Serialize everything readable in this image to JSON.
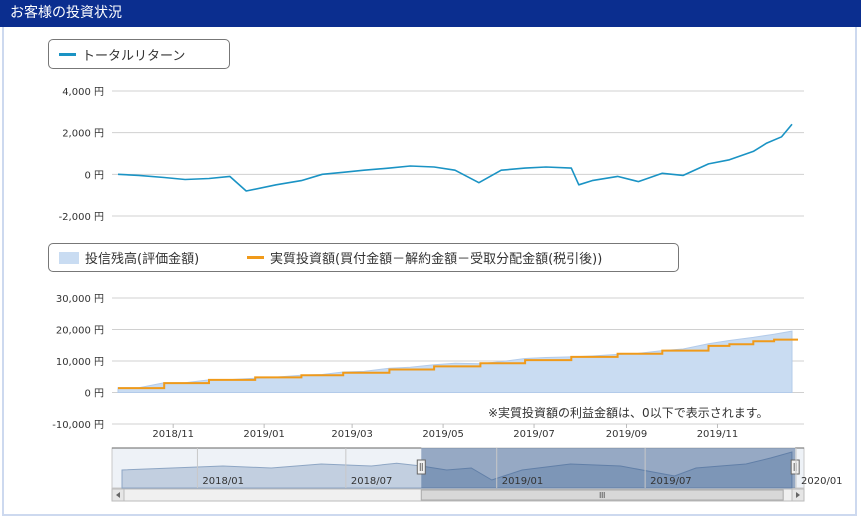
{
  "header": {
    "title": "お客様の投資状況"
  },
  "legends": {
    "top": {
      "label": "トータルリターン",
      "color": "#1a93c4"
    },
    "bottom": {
      "area_label": "投信残高(評価金額)",
      "area_color": "#c9dcf2",
      "line_label": "実質投資額(買付金額－解約金額－受取分配金額(税引後))",
      "line_color": "#f09a1a"
    }
  },
  "note": "※実質投資額の利益金額は、0以下で表示されます。",
  "chart_data": [
    {
      "type": "line",
      "title": "",
      "series": [
        {
          "name": "トータルリターン",
          "color": "#1a93c4",
          "x": [
            "2018/10/01",
            "2018/10/15",
            "2018/11/01",
            "2018/11/15",
            "2018/12/01",
            "2018/12/15",
            "2018/12/26",
            "2019/01/15",
            "2019/02/01",
            "2019/02/15",
            "2019/03/01",
            "2019/03/15",
            "2019/04/01",
            "2019/04/15",
            "2019/05/01",
            "2019/05/15",
            "2019/05/31",
            "2019/06/15",
            "2019/07/01",
            "2019/07/15",
            "2019/08/01",
            "2019/08/06",
            "2019/08/15",
            "2019/09/01",
            "2019/09/15",
            "2019/10/01",
            "2019/10/15",
            "2019/11/01",
            "2019/11/15",
            "2019/12/01",
            "2019/12/10",
            "2019/12/20",
            "2019/12/27"
          ],
          "values": [
            0,
            -50,
            -150,
            -250,
            -200,
            -100,
            -800,
            -500,
            -300,
            0,
            100,
            200,
            300,
            400,
            350,
            200,
            -400,
            200,
            300,
            350,
            300,
            -500,
            -300,
            -100,
            -350,
            50,
            -50,
            500,
            700,
            1100,
            1500,
            1800,
            2400
          ]
        }
      ],
      "ylim": [
        -2000,
        4000
      ],
      "yticks": [
        "4,000 円",
        "2,000 円",
        "0 円",
        "-2,000 円"
      ]
    },
    {
      "type": "area",
      "title": "",
      "x": [
        "2018/10/01",
        "2018/10/15",
        "2018/11/01",
        "2018/11/15",
        "2018/12/01",
        "2018/12/15",
        "2019/01/01",
        "2019/01/15",
        "2019/02/01",
        "2019/02/15",
        "2019/03/01",
        "2019/03/15",
        "2019/04/01",
        "2019/04/15",
        "2019/05/01",
        "2019/05/15",
        "2019/06/01",
        "2019/06/15",
        "2019/07/01",
        "2019/07/15",
        "2019/08/01",
        "2019/08/15",
        "2019/09/01",
        "2019/09/15",
        "2019/10/01",
        "2019/10/15",
        "2019/11/01",
        "2019/11/15",
        "2019/12/01",
        "2019/12/15",
        "2019/12/27"
      ],
      "series": [
        {
          "name": "投信残高(評価金額)",
          "kind": "area",
          "color": "#c9dcf2",
          "values": [
            1500,
            1500,
            3100,
            3100,
            4000,
            4100,
            4500,
            4900,
            5500,
            5700,
            6500,
            6700,
            7700,
            8000,
            8800,
            9300,
            9100,
            9800,
            10800,
            11100,
            11300,
            11600,
            12100,
            12400,
            13300,
            13800,
            15500,
            16500,
            17500,
            18500,
            19500
          ]
        },
        {
          "name": "実質投資額(買付金額－解約金額－受取分配金額(税引後))",
          "kind": "line",
          "color": "#f09a1a",
          "values": [
            1400,
            1400,
            3000,
            3000,
            4000,
            4000,
            4800,
            4800,
            5500,
            5500,
            6300,
            6300,
            7300,
            7300,
            8300,
            8300,
            9300,
            9300,
            10300,
            10300,
            11300,
            11300,
            12300,
            12300,
            13300,
            13300,
            14800,
            15300,
            16300,
            16800,
            16800
          ]
        }
      ],
      "ylim": [
        -10000,
        30000
      ],
      "yticks": [
        "30,000 円",
        "20,000 円",
        "10,000 円",
        "0 円",
        "-10,000 円"
      ],
      "xticks": [
        "2018/11",
        "2019/01",
        "2019/03",
        "2019/05",
        "2019/07",
        "2019/09",
        "2019/11"
      ]
    },
    {
      "type": "area",
      "title": "",
      "role": "navigator",
      "x_start": "2017/10/01",
      "x_end": "2020/01/01",
      "selection": [
        "2018/10/01",
        "2019/12/31"
      ],
      "xticks": [
        "2018/01",
        "2018/07",
        "2019/01",
        "2019/07",
        "2020/01"
      ],
      "x": [
        "2017/10/01",
        "2017/12/01",
        "2018/02/01",
        "2018/04/01",
        "2018/06/01",
        "2018/08/01",
        "2018/09/01",
        "2018/10/01",
        "2018/11/01",
        "2018/12/01",
        "2018/12/26",
        "2019/02/01",
        "2019/04/01",
        "2019/06/01",
        "2019/08/06",
        "2019/09/01",
        "2019/10/01",
        "2019/11/01",
        "2019/12/01",
        "2019/12/27"
      ],
      "values": [
        0.45,
        0.5,
        0.55,
        0.5,
        0.6,
        0.55,
        0.62,
        0.55,
        0.45,
        0.5,
        0.2,
        0.45,
        0.6,
        0.55,
        0.3,
        0.5,
        0.55,
        0.6,
        0.75,
        0.9
      ]
    }
  ]
}
